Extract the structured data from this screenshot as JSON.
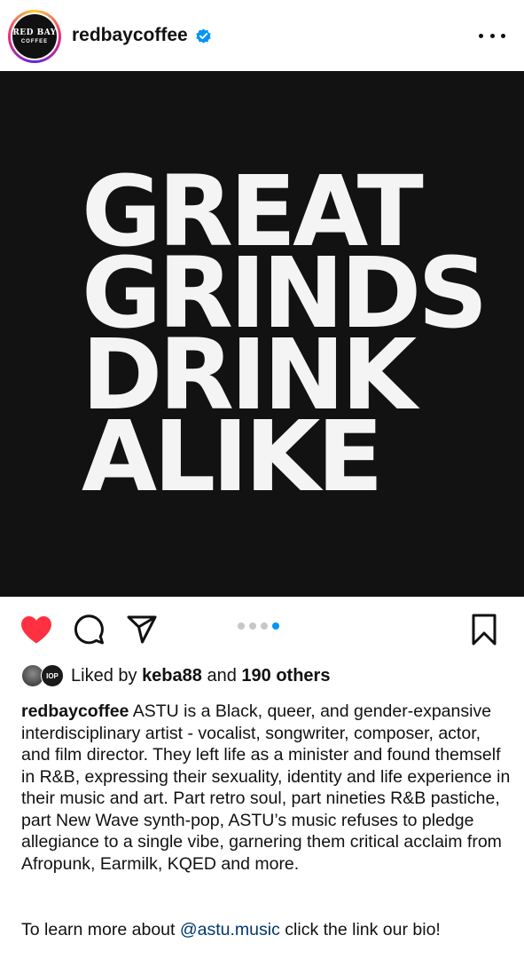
{
  "post": {
    "avatar_line1": "RED BAY",
    "avatar_line2": "COFFEE",
    "username": "redbaycoffee",
    "verified": true,
    "image_lines": [
      "GREAT",
      "GRINDS",
      "DRINK",
      "ALIKE"
    ],
    "carousel": {
      "count": 4,
      "active_index": 4
    },
    "liked": true
  },
  "likes": {
    "prefix": "Liked by ",
    "user": "keba88",
    "middle": " and ",
    "others": "190 others",
    "avatar2_text": "IOP"
  },
  "caption": {
    "username": "redbaycoffee",
    "text": " ASTU is a Black, queer, and gender-expansive interdisciplinary artist - vocalist, songwriter, composer, actor, and film director. They left life as a minister and found themself in R&B, expressing their sexuality, identity and life experience in their music and art. Part retro soul, part nineties R&B pastiche, part New Wave synth-pop, ASTU’s music refuses to pledge allegiance to a single vibe, garnering them critical acclaim from Afropunk, Earmilk, KQED and more.",
    "cta_prefix": "To learn more about ",
    "cta_mention": "@astu.music",
    "cta_suffix": " click the link our bio!"
  },
  "colors": {
    "like_red": "#ff3040",
    "verified_blue": "#0095f6",
    "active_dot": "#0095f6",
    "mention": "#00376b",
    "image_background": "#121212"
  }
}
